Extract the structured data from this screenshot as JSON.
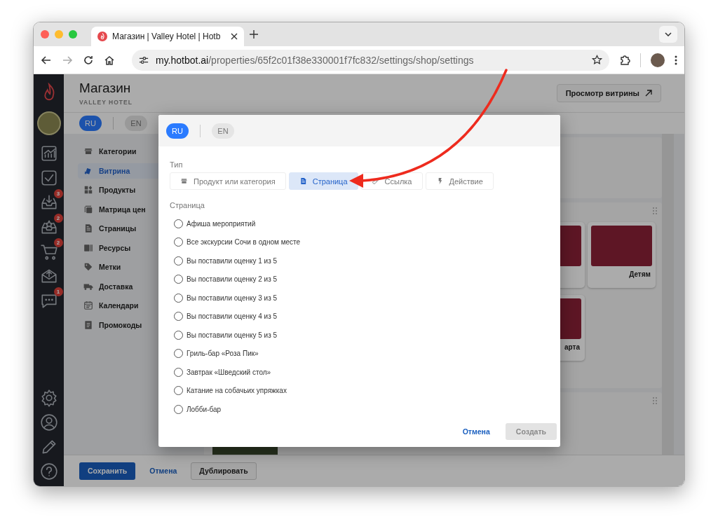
{
  "browser": {
    "tab_title": "Магазин | Valley Hotel | Hotb",
    "url_domain": "my.hotbot.ai",
    "url_path": "/properties/65f2c01f38e330001f7fc832/settings/shop/settings"
  },
  "rail": {
    "top": [
      {
        "kind": "analytics"
      },
      {
        "kind": "tasks"
      },
      {
        "kind": "inbox",
        "badge": "3"
      },
      {
        "kind": "reviews",
        "badge": "2"
      },
      {
        "kind": "cart",
        "badge": "2"
      },
      {
        "kind": "mail"
      },
      {
        "kind": "chat",
        "badge": "1"
      }
    ],
    "bottom": [
      {
        "kind": "settings"
      },
      {
        "kind": "profile"
      },
      {
        "kind": "edit"
      },
      {
        "kind": "help"
      }
    ]
  },
  "header": {
    "title": "Магазин",
    "subtitle": "VALLEY HOTEL",
    "preview_button": "Просмотр витрины"
  },
  "languages": [
    {
      "label": "RU",
      "selected": true
    },
    {
      "label": "EN",
      "selected": false
    }
  ],
  "nav": [
    {
      "label": "Категории",
      "kind": "store",
      "selected": false
    },
    {
      "label": "Витрина",
      "kind": "showcase",
      "selected": true
    },
    {
      "label": "Продукты",
      "kind": "products",
      "selected": false
    },
    {
      "label": "Матрица цен",
      "kind": "matrix",
      "selected": false
    },
    {
      "label": "Страницы",
      "kind": "page",
      "selected": false
    },
    {
      "label": "Ресурсы",
      "kind": "resources",
      "selected": false
    },
    {
      "label": "Метки",
      "kind": "tag",
      "selected": false
    },
    {
      "label": "Доставка",
      "kind": "truck",
      "selected": false
    },
    {
      "label": "Календари",
      "kind": "calendar",
      "selected": false
    },
    {
      "label": "Промокоды",
      "kind": "promo",
      "selected": false
    }
  ],
  "cards": [
    {
      "kind": "photo"
    },
    {
      "kind": "titled",
      "title": "Детям"
    },
    {
      "kind": "titled",
      "title": "арта"
    }
  ],
  "footer": {
    "save": "Сохранить",
    "cancel": "Отмена",
    "duplicate": "Дублировать"
  },
  "dialog": {
    "languages": [
      {
        "label": "RU",
        "selected": true
      },
      {
        "label": "EN",
        "selected": false
      }
    ],
    "type_label": "Тип",
    "types": [
      {
        "label": "Продукт или категория",
        "kind": "store",
        "selected": false
      },
      {
        "label": "Страница",
        "kind": "page",
        "selected": true
      },
      {
        "label": "Ссылка",
        "kind": "link",
        "selected": false
      },
      {
        "label": "Действие",
        "kind": "bolt",
        "selected": false
      }
    ],
    "page_label": "Страница",
    "pages": [
      {
        "label": "Афиша мероприятий",
        "selected": false
      },
      {
        "label": "Все экскурсии Сочи в одном месте",
        "selected": false
      },
      {
        "label": "Вы поставили оценку 1 из 5",
        "selected": false
      },
      {
        "label": "Вы поставили оценку 2 из 5",
        "selected": false
      },
      {
        "label": "Вы поставили оценку 3 из 5",
        "selected": false
      },
      {
        "label": "Вы поставили оценку 4 из 5",
        "selected": false
      },
      {
        "label": "Вы поставили оценку 5 из 5",
        "selected": false
      },
      {
        "label": "Гриль-бар «Роза Пик»",
        "selected": false
      },
      {
        "label": "Завтрак «Шведский стол»",
        "selected": false
      },
      {
        "label": "Катание на собачьих упряжках",
        "selected": false
      },
      {
        "label": "Лобби-бар",
        "selected": false
      }
    ],
    "cancel": "Отмена",
    "create": "Создать",
    "create_disabled": true
  }
}
